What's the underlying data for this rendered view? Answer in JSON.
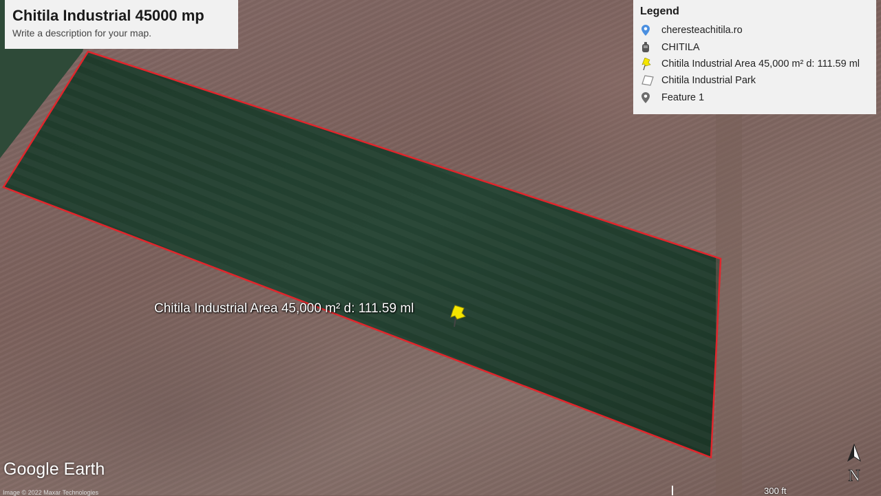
{
  "map": {
    "title": "Chitila Industrial 45000 mp",
    "description": "Write a description for your map.",
    "placemark_label": "Chitila Industrial Area 45,000 m² d: 111.59 ml",
    "logo": "Google Earth",
    "credit": "Image © 2022 Maxar Technologies",
    "scale_label": "300 ft",
    "north_label": "N",
    "boundary_color": "#e0262c"
  },
  "legend": {
    "title": "Legend",
    "items": [
      {
        "label": "cheresteachitila.ro",
        "icon": "blue-placemark-icon",
        "color": "#4a8fe0"
      },
      {
        "label": "CHITILA",
        "icon": "gray-building-icon",
        "color": "#555555"
      },
      {
        "label": "Chitila Industrial Area 45,000 m² d: 111.59 ml",
        "icon": "yellow-pushpin-icon",
        "color": "#f5e600"
      },
      {
        "label": "Chitila Industrial Park",
        "icon": "polygon-icon",
        "color": "#888888"
      },
      {
        "label": "Feature 1",
        "icon": "gray-placemark-icon",
        "color": "#6c6c6c"
      }
    ]
  }
}
